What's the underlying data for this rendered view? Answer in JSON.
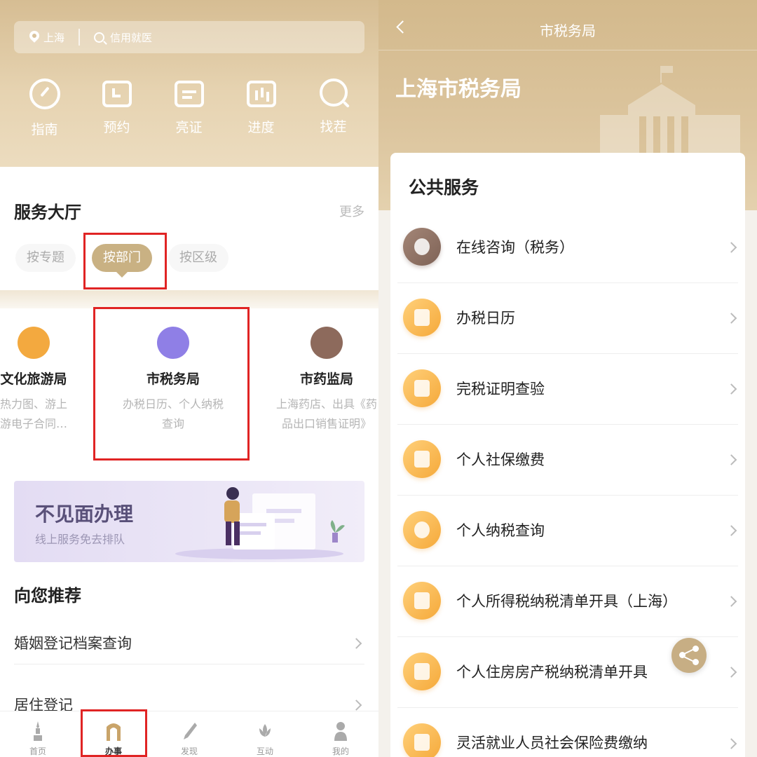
{
  "left": {
    "search": {
      "location": "上海",
      "placeholder": "信用就医"
    },
    "quick_actions": [
      {
        "label": "指南",
        "icon": "gauge-icon"
      },
      {
        "label": "预约",
        "icon": "calendar-icon"
      },
      {
        "label": "亮证",
        "icon": "id-card-icon"
      },
      {
        "label": "进度",
        "icon": "bar-chart-icon"
      },
      {
        "label": "找茬",
        "icon": "search-icon"
      }
    ],
    "hall": {
      "title": "服务大厅",
      "more": "更多",
      "chips": [
        "按专题",
        "按部门",
        "按区级"
      ],
      "active_chip": "按部门"
    },
    "departments": [
      {
        "name": "文化旅游局",
        "desc_line1": "热力图、游上",
        "desc_line2": "游电子合同…",
        "icon": "palace-icon",
        "color": "#f3a93f"
      },
      {
        "name": "市税务局",
        "desc_line1": "办税日历、个人纳税",
        "desc_line2": "查询",
        "icon": "tax-emblem-icon",
        "color": "#8f7fe6"
      },
      {
        "name": "市药监局",
        "desc_line1": "上海药店、出具《药",
        "desc_line2": "品出口销售证明》",
        "icon": "medicine-icon",
        "color": "#8d6a5c"
      }
    ],
    "banner": {
      "title": "不见面办理",
      "subtitle": "线上服务免去排队"
    },
    "recommend": {
      "title": "向您推荐",
      "items": [
        "婚姻登记档案查询",
        "居住登记"
      ]
    },
    "tabbar": [
      {
        "label": "首页",
        "icon": "pagoda-icon"
      },
      {
        "label": "办事",
        "icon": "gate-icon",
        "active": true
      },
      {
        "label": "发现",
        "icon": "pen-icon"
      },
      {
        "label": "互动",
        "icon": "flower-icon"
      },
      {
        "label": "我的",
        "icon": "person-icon"
      }
    ]
  },
  "right": {
    "nav_title": "市税务局",
    "bureau_title": "上海市税务局",
    "section_title": "公共服务",
    "services": [
      {
        "label": "在线咨询（税务）",
        "icon": "support-agent-icon"
      },
      {
        "label": "办税日历",
        "icon": "calendar-icon"
      },
      {
        "label": "完税证明查验",
        "icon": "tax-certificate-icon"
      },
      {
        "label": "个人社保缴费",
        "icon": "social-security-icon"
      },
      {
        "label": "个人纳税查询",
        "icon": "coin-hand-icon"
      },
      {
        "label": "个人所得税纳税清单开具（上海）",
        "icon": "tax-list-icon"
      },
      {
        "label": "个人住房房产税纳税清单开具",
        "icon": "property-tax-icon"
      },
      {
        "label": "灵活就业人员社会保险费缴纳",
        "icon": "insurance-icon"
      }
    ]
  },
  "colors": {
    "gold": "#c9b183",
    "highlight": "#e02424",
    "banner": "#595079"
  }
}
